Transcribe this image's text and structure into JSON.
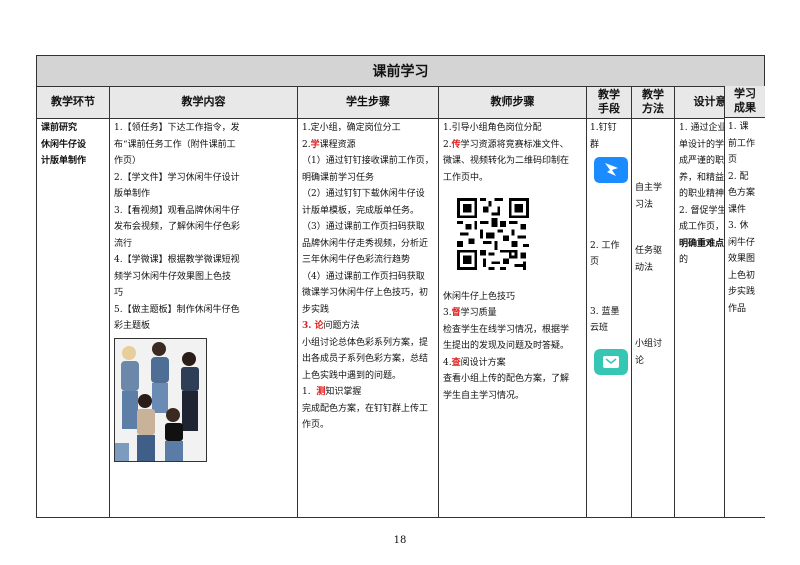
{
  "title": "课前学习",
  "headers": {
    "stage": "教学环节",
    "content": "教学内容",
    "student": "学生步骤",
    "teacher": "教师步骤",
    "means": [
      "教学",
      "手段"
    ],
    "method": [
      "教学",
      "方法"
    ],
    "intent": "设计意图",
    "outcome": [
      "学习",
      "成果"
    ]
  },
  "stage": {
    "line1": "课前研究",
    "line2": "休闲牛仔设",
    "line3": "计版单制作"
  },
  "content": {
    "l1": "1.【领任务】下达工作指令，发",
    "l2": "布“课前任务工作（附件课前工",
    "l3": "作页）",
    "l4": "2.【学文件】学习休闲牛仔设计",
    "l5": "版单制作",
    "l6": "3.【看视频】观看品牌休闲牛仔",
    "l7": "发布会视频，了解休闲牛仔色彩",
    "l8": "流行",
    "l9": "4.【学微课】根据教学微课短视",
    "l10": "频学习休闲牛仔效果图上色技",
    "l11": "巧",
    "l12": "5.【做主题板】制作休闲牛仔色",
    "l13": "彩主题板"
  },
  "student": {
    "l1": "1.定小组，确定岗位分工",
    "l2_num": "2.",
    "l2_red": "学",
    "l2_rest": "课程资源",
    "l3": "（1）通过钉钉接收课前工作页，",
    "l4": "明确课前学习任务",
    "l5": "（2）通过钉钉下载休闲牛仔设",
    "l6": "计版单模板，完成版单任务。",
    "l7": "（3）通过课前工作页扫码获取",
    "l8": "品牌休闲牛仔走秀视频，分析近",
    "l9": "三年休闲牛仔色彩流行趋势",
    "l10": "（4）通过课前工作页扫码获取",
    "l11": "微课学习休闲牛仔上色技巧，初",
    "l12": "步实践",
    "l13_red": "3. 论",
    "l13_rest": "问题方法",
    "l14": "小组讨论总体色彩系列方案，提",
    "l15": "出各成员子系列色彩方案，总结",
    "l16": "上色实践中遇到的问题。",
    "l17_num": "1.  ",
    "l17_red": "测",
    "l17_rest": "知识掌握",
    "l18": "完成配色方案，在钉钉群上传工",
    "l19": "作页。"
  },
  "teacher": {
    "l1": "1.引导小组角色岗位分配",
    "l2_num": "2.",
    "l2_red": "传",
    "l2_rest": "学习资源将竞赛标准文件、",
    "l3": "微课、视频转化为二维码印制在",
    "l4": "工作页中。",
    "l5": "休闲牛仔上色技巧",
    "l6_num": "3.",
    "l6_red": "督",
    "l6_rest": "学习质量",
    "l7": "检查学生在线学习情况，根据学",
    "l8": "生提出的发现及问题及时答疑。",
    "l9_num": "4.",
    "l9_red": "查",
    "l9_rest": "阅设计方案",
    "l10": "查看小组上传的配色方案，了解",
    "l11": "学生自主学习情况。"
  },
  "means": {
    "l1": "1.钉钉",
    "l2": "群",
    "l3": "2. 工作",
    "l4": "页",
    "l5": "3. 蓝墨",
    "l6": "云班"
  },
  "method": {
    "l1": "自主学",
    "l2": "习法",
    "l3": "任务驱",
    "l4": "动法",
    "l5": "小组讨",
    "l6": "论"
  },
  "intent": {
    "l1": "1. 通过企业版",
    "l2": "单设计的学习养",
    "l3": "成严谨的职业素",
    "l4": "养，和精益求精",
    "l5": "的职业精神",
    "l6": "2. 督促学生完",
    "l7": "成工作页，达到",
    "l8_bold": "明确重难点",
    "l8_rest": "的目",
    "l9": "的"
  },
  "outcome": {
    "l1": "1. 课",
    "l2": "前工作",
    "l3": "页",
    "l4": "2. 配",
    "l5": "色方案",
    "l6": "课件",
    "l7": "3. 休",
    "l8": "闲牛仔",
    "l9": "效果图",
    "l10": "上色初",
    "l11": "步实践",
    "l12": "作品"
  },
  "page_number": "18",
  "colors": {
    "title_bg": "#d4d4d4",
    "header_bg": "#e8e8e8",
    "highlight_red": "#e02020",
    "dingtalk_blue": "#1a8cff",
    "mosoteach_teal": "#36c6b4"
  },
  "icons": [
    "dingtalk-icon",
    "mosoteach-icon",
    "qr-code"
  ]
}
